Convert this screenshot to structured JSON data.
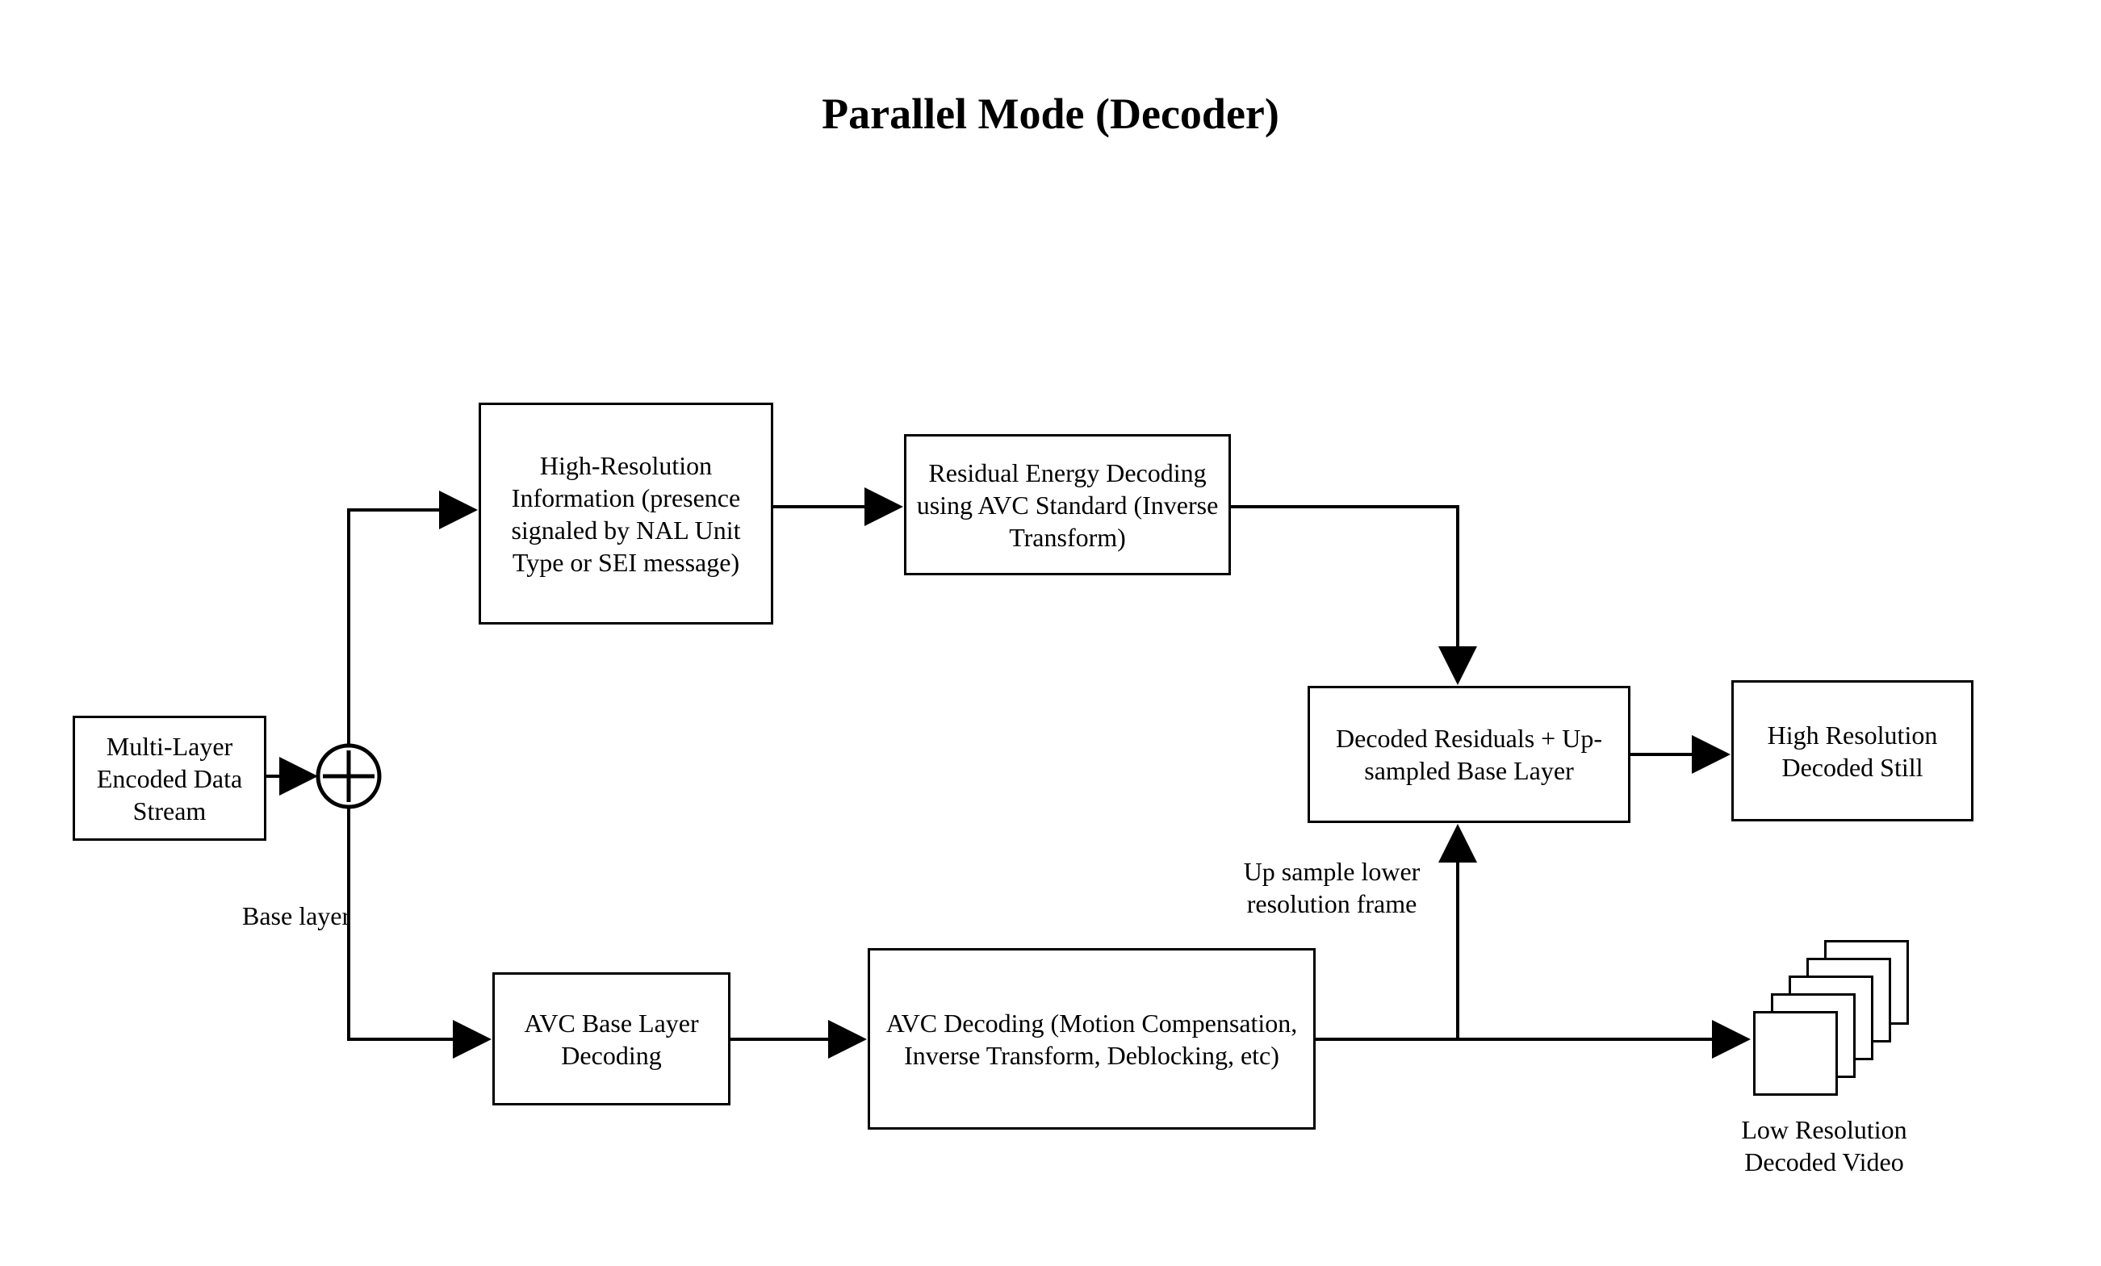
{
  "title": "Parallel Mode (Decoder)",
  "boxes": {
    "input": "Multi-Layer\nEncoded Data\nStream",
    "hri": "High-Resolution\nInformation\n(presence signaled\nby NAL Unit Type\nor SEI message)",
    "red": "Residual Energy Decoding\nusing AVC Standard\n(Inverse Transform)",
    "sum": "Decoded Residuals\n+\nUp-sampled Base Layer",
    "hrds": "High Resolution\nDecoded Still",
    "abld": "AVC\nBase Layer\nDecoding",
    "avc": "AVC Decoding\n(Motion Compensation,\nInverse Transform, Deblocking,\netc)"
  },
  "labels": {
    "baseLayer": "Base layer",
    "upsample": "Up sample lower\nresolution frame",
    "lowRes": "Low Resolution\nDecoded Video"
  }
}
